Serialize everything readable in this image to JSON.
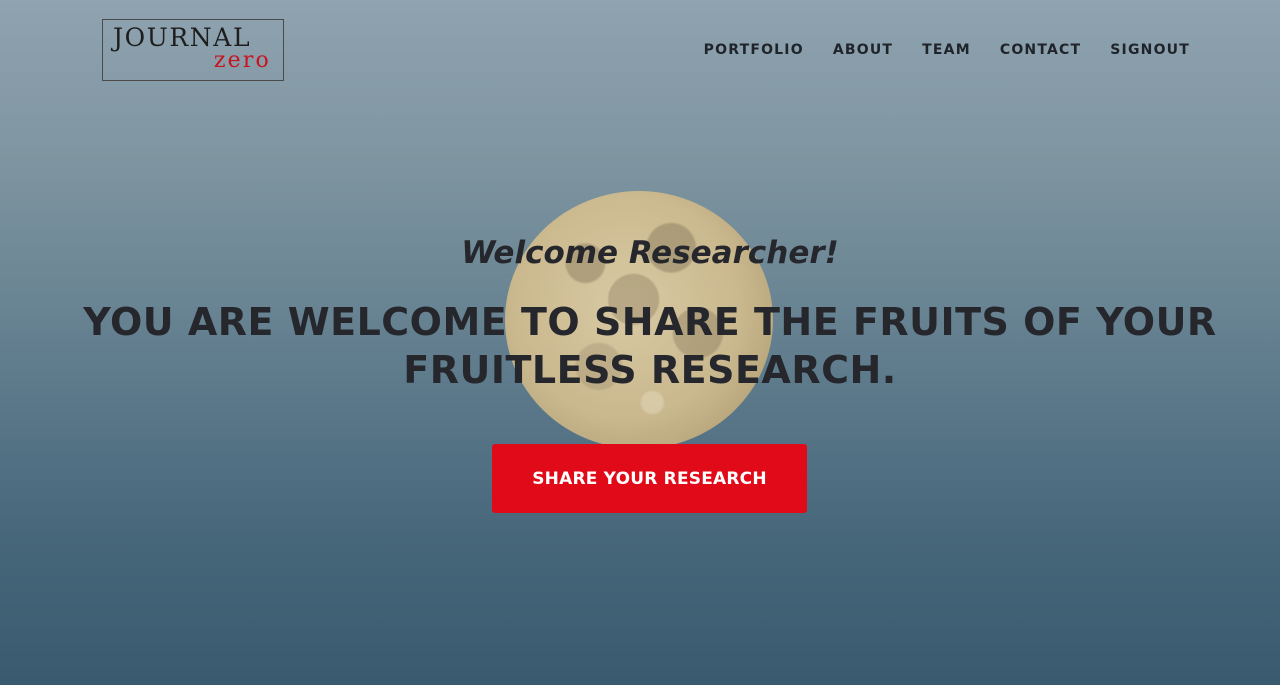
{
  "brand": {
    "logo_line1": "JOURNAL",
    "logo_line2": "zero",
    "logo_accent_color": "#c8141e"
  },
  "nav": {
    "items": [
      {
        "label": "PORTFOLIO"
      },
      {
        "label": "ABOUT"
      },
      {
        "label": "TEAM"
      },
      {
        "label": "CONTACT"
      },
      {
        "label": "SIGNOUT"
      }
    ]
  },
  "hero": {
    "greeting": "Welcome Researcher!",
    "headline_line1": "YOU ARE WELCOME TO SHARE THE FRUITS OF YOUR",
    "headline_line2": "FRUITLESS RESEARCH.",
    "cta_label": "SHARE YOUR RESEARCH",
    "cta_color": "#e00a18",
    "background_image": "full moon over blue dusk sky"
  }
}
